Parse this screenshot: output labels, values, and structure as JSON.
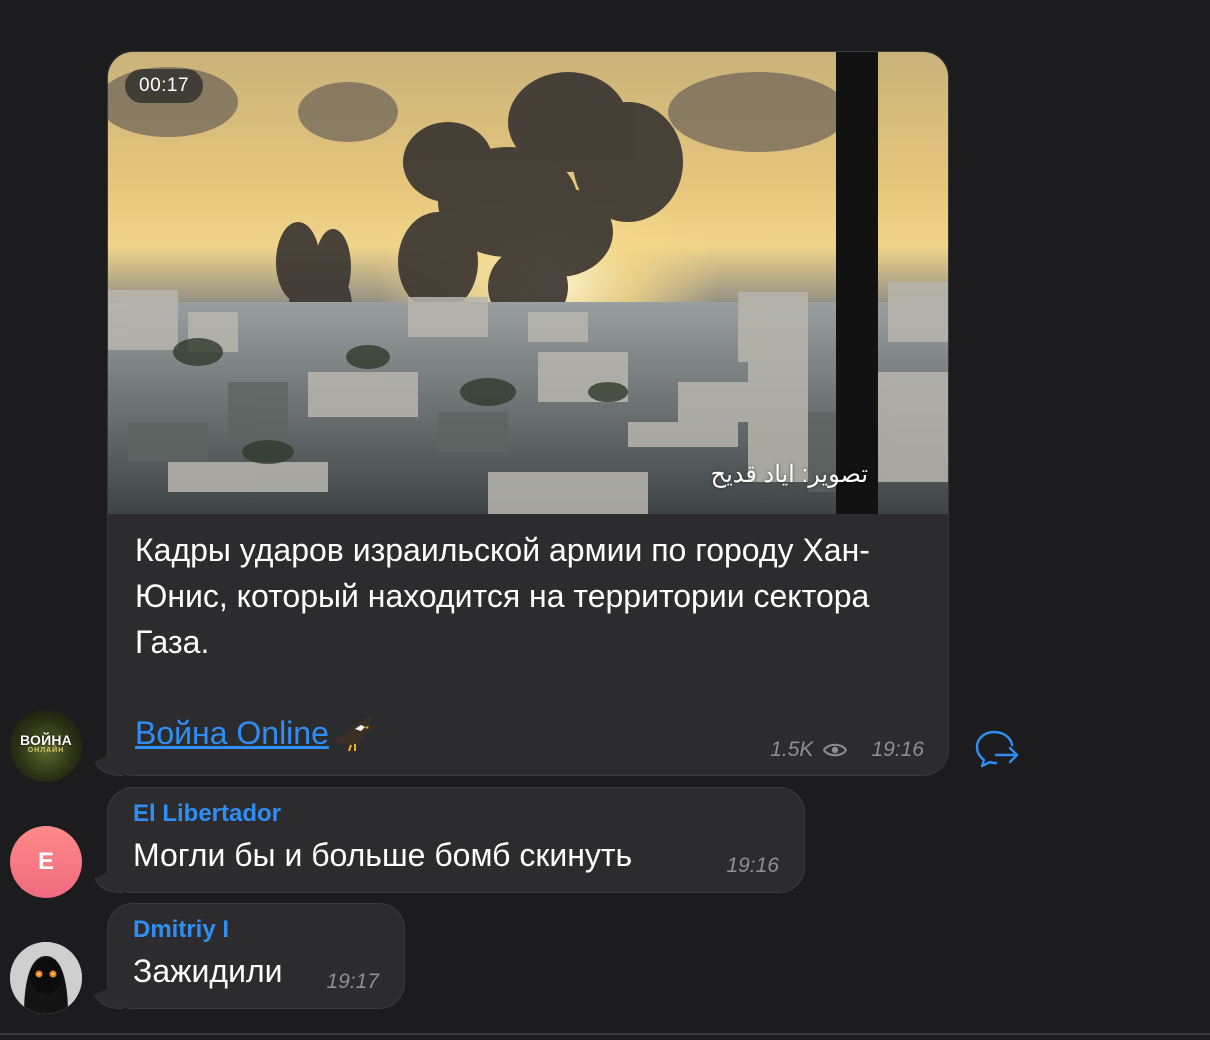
{
  "post": {
    "duration": "00:17",
    "watermark": "تصوير: اياد قديح",
    "text": "Кадры ударов израильской армии по городу Хан-Юнис, который находится на территории сектора Газа.",
    "link_label": "Война Online",
    "views": "1.5K",
    "time": "19:16",
    "channel_avatar_text": "ВОЙНА",
    "channel_avatar_sub": "ОНЛАЙН"
  },
  "messages": [
    {
      "sender": "El Libertador",
      "avatar_letter": "E",
      "text": "Могли бы и больше бомб скинуть",
      "time": "19:16"
    },
    {
      "sender": "Dmitriy I",
      "text": "Зажидили",
      "time": "19:17"
    }
  ],
  "colors": {
    "background": "#1c1c1e",
    "bubble": "#2c2c2e",
    "accent": "#2f8ef4",
    "meta": "#8e8e93"
  },
  "icons": {
    "views": "eye-icon",
    "forward": "share-arrow-icon",
    "link_emoji": "eagle-icon"
  }
}
